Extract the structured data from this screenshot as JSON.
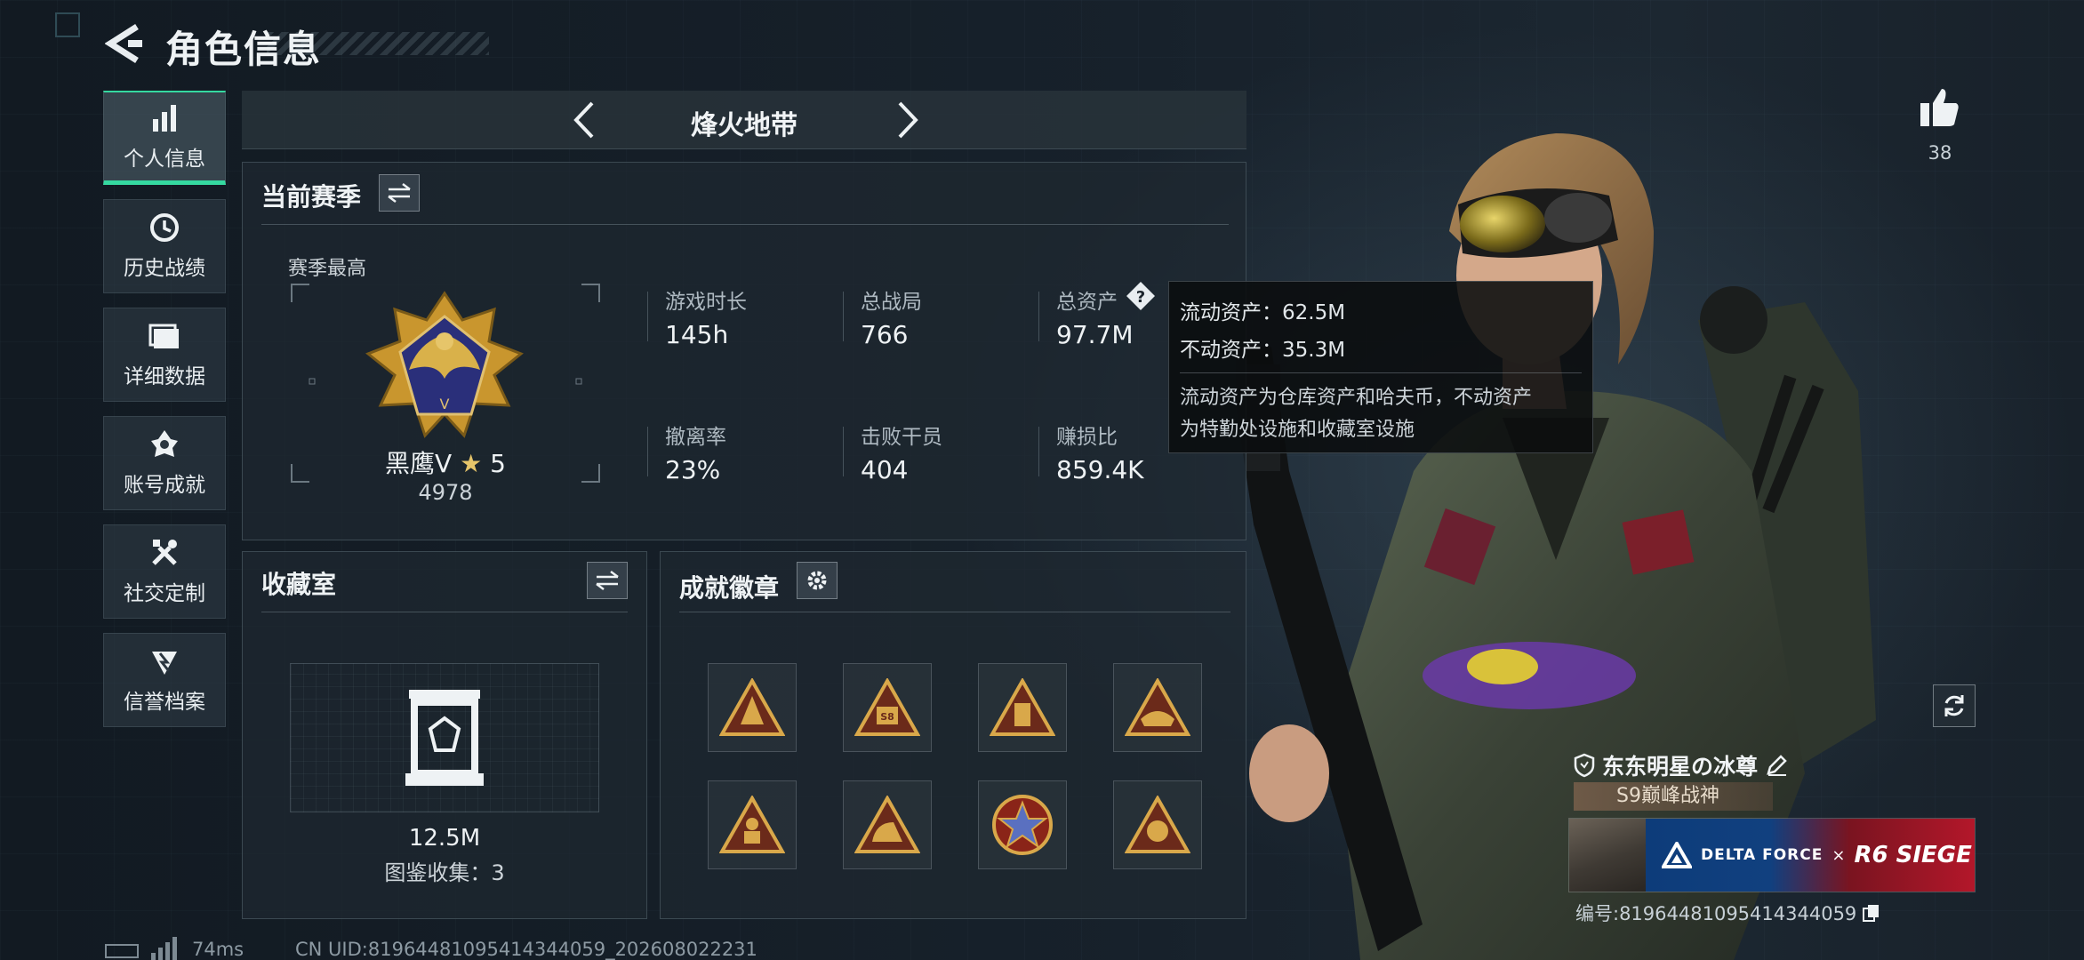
{
  "header": {
    "title": "角色信息"
  },
  "nav": {
    "items": [
      {
        "label": "个人信息",
        "icon": "bar-chart-icon",
        "active": true
      },
      {
        "label": "历史战绩",
        "icon": "clock-icon",
        "active": false
      },
      {
        "label": "详细数据",
        "icon": "folder-icon",
        "active": false
      },
      {
        "label": "账号成就",
        "icon": "achievement-icon",
        "active": false
      },
      {
        "label": "社交定制",
        "icon": "tools-icon",
        "active": false
      },
      {
        "label": "信誉档案",
        "icon": "shield-badge-icon",
        "active": false
      }
    ]
  },
  "mode": {
    "title": "烽火地带"
  },
  "season": {
    "title": "当前赛季",
    "best_label": "赛季最高",
    "rank_name": "黑鹰V",
    "rank_stars": "5",
    "rank_score": "4978",
    "stats": [
      {
        "label": "游戏时长",
        "value": "145h"
      },
      {
        "label": "总战局",
        "value": "766"
      },
      {
        "label": "总资产",
        "value": "97.7M"
      },
      {
        "label": "撤离率",
        "value": "23%"
      },
      {
        "label": "击败干员",
        "value": "404"
      },
      {
        "label": "赚损比",
        "value": "859.4K"
      }
    ]
  },
  "tooltip": {
    "liquid": "流动资产：62.5M",
    "fixed": "不动资产：35.3M",
    "desc_line1": "流动资产为仓库资产和哈夫币，不动资产",
    "desc_line2": "为特勤处设施和收藏室设施"
  },
  "collection": {
    "title": "收藏室",
    "value": "12.5M",
    "catalog": "图鉴收集：3"
  },
  "achievements": {
    "title": "成就徽章",
    "badges": [
      "badge-1",
      "badge-2",
      "badge-3",
      "badge-4",
      "badge-5",
      "badge-6",
      "badge-7",
      "badge-8"
    ]
  },
  "footer": {
    "ping": "74ms",
    "uid": "CN UID:819644810954143440​59_202608022231"
  },
  "profile": {
    "likes": "38",
    "player_name": "东东明星の冰尊",
    "rank_tag": "S9巅峰战神",
    "banner_left": "DELTA FORCE",
    "banner_x": "×",
    "banner_right": "R6 SIEGE",
    "serial": "编号:81964481095414344059"
  },
  "colors": {
    "accent": "#35d9a0",
    "gold": "#c9962e",
    "banner_blue": "#11407f",
    "banner_red": "#b3172a"
  }
}
